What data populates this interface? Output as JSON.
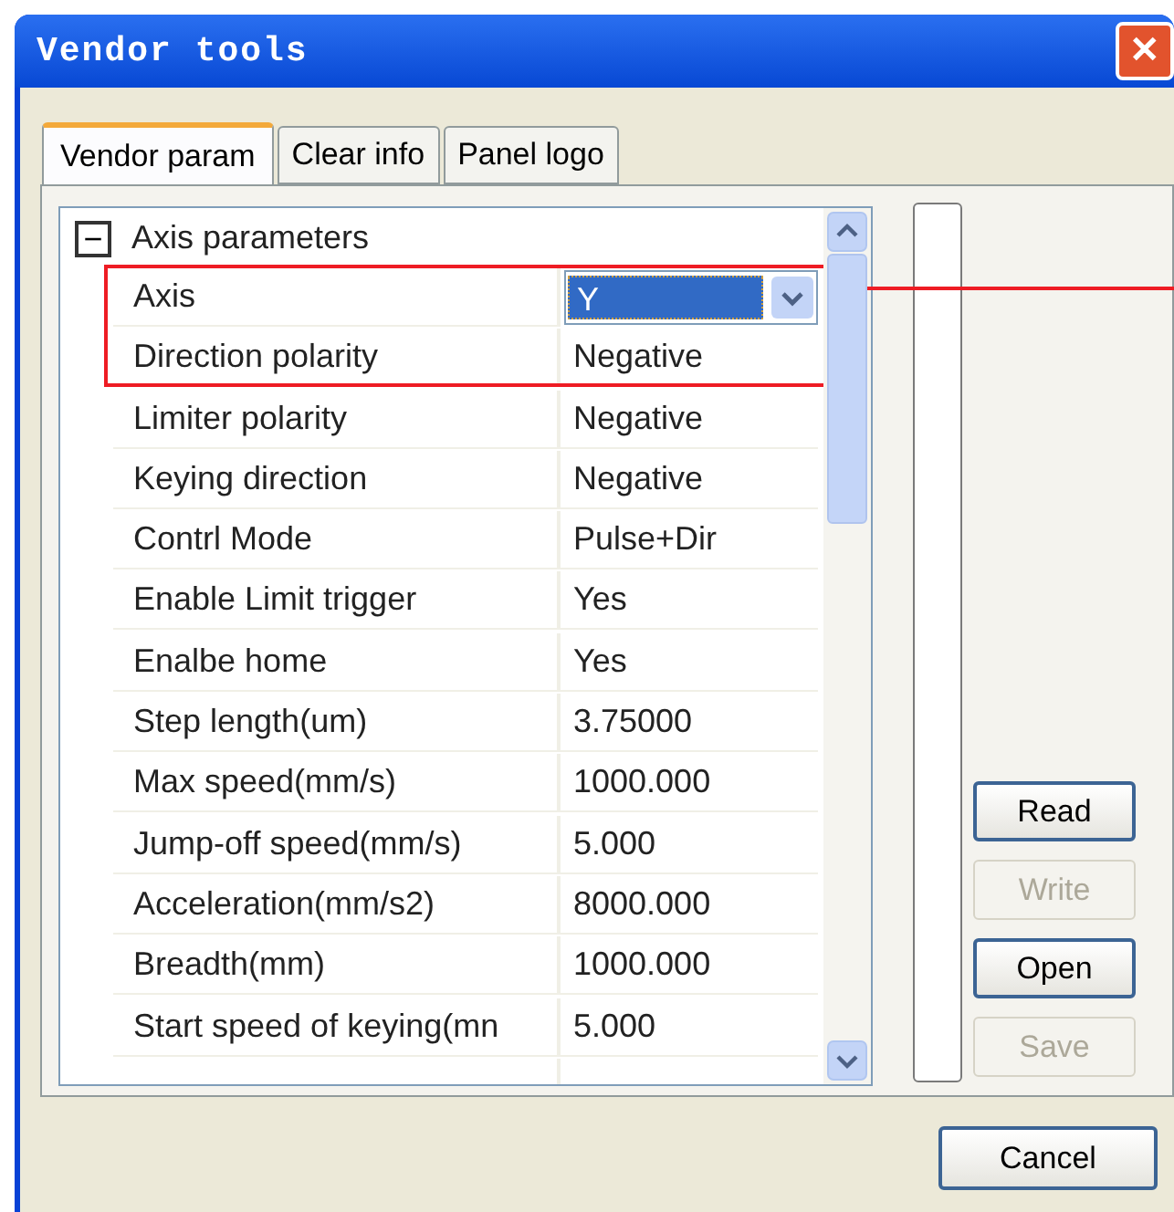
{
  "window": {
    "title": "Vendor tools",
    "close": "✕"
  },
  "tabs": [
    {
      "label": "Vendor param",
      "selected": true
    },
    {
      "label": "Clear info",
      "selected": false
    },
    {
      "label": "Panel logo",
      "selected": false
    }
  ],
  "property_grid": {
    "group": {
      "label": "Axis parameters",
      "expanded": true,
      "toggle": "−"
    },
    "rows": [
      {
        "kind": "dropdown",
        "name": "Axis",
        "value": "Y"
      },
      {
        "kind": "text",
        "name": "Direction polarity",
        "value": "Negative"
      },
      {
        "kind": "text",
        "name": "Limiter polarity",
        "value": "Negative"
      },
      {
        "kind": "text",
        "name": "Keying direction",
        "value": "Negative"
      },
      {
        "kind": "text",
        "name": "Contrl Mode",
        "value": "Pulse+Dir"
      },
      {
        "kind": "text",
        "name": "Enable Limit trigger",
        "value": "Yes"
      },
      {
        "kind": "text",
        "name": "Enalbe home",
        "value": "Yes"
      },
      {
        "kind": "text",
        "name": "Step length(um)",
        "value": "3.75000"
      },
      {
        "kind": "text",
        "name": "Max speed(mm/s)",
        "value": "1000.000"
      },
      {
        "kind": "text",
        "name": "Jump-off speed(mm/s)",
        "value": "5.000"
      },
      {
        "kind": "text",
        "name": "Acceleration(mm/s2)",
        "value": "8000.000"
      },
      {
        "kind": "text",
        "name": "Breadth(mm)",
        "value": "1000.000"
      },
      {
        "kind": "text",
        "name": "Start speed of keying(mn",
        "value": "5.000"
      }
    ]
  },
  "side_buttons": [
    {
      "label": "Read",
      "disabled": false
    },
    {
      "label": "Write",
      "disabled": true
    },
    {
      "label": "Open",
      "disabled": false
    },
    {
      "label": "Save",
      "disabled": true
    }
  ],
  "footer_buttons": [
    {
      "label": "Cancel",
      "disabled": false
    }
  ]
}
